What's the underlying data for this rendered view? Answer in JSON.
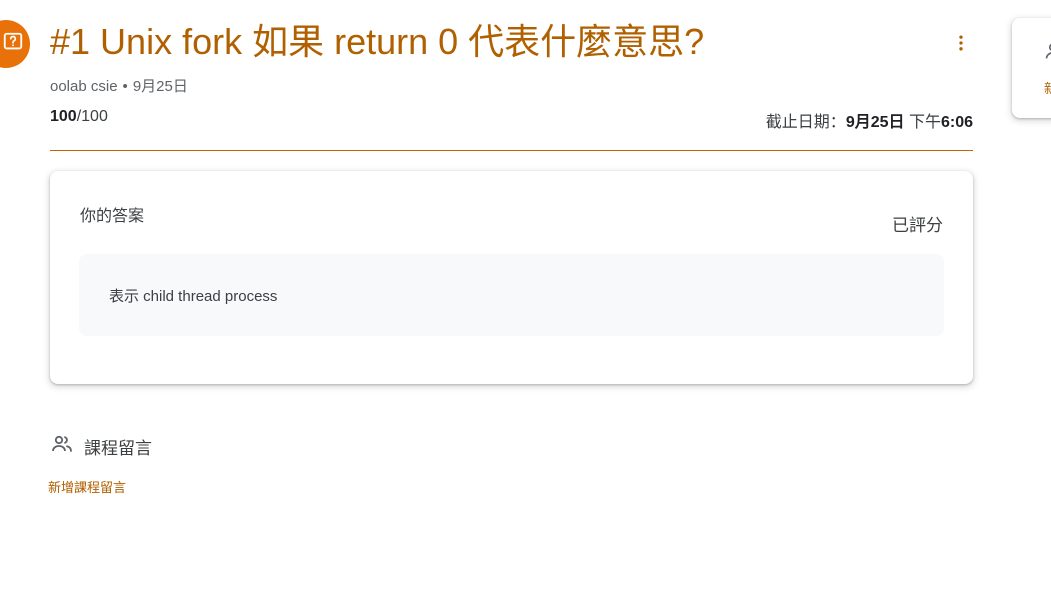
{
  "assignment": {
    "title": "#1 Unix fork 如果 return 0 代表什麼意思?",
    "author": "oolab csie",
    "separator": "•",
    "posted_date": "9月25日",
    "points_earned": "100",
    "points_total": "/100",
    "due_label": "截止日期：",
    "due_date": "9月25日",
    "due_time_prefix": " 下午",
    "due_time": "6:06"
  },
  "your_answer": {
    "heading": "你的答案",
    "status": "已評分",
    "text": "表示 child thread process"
  },
  "class_comments": {
    "title": "課程留言",
    "add_label": "新增課程留言"
  },
  "side_panel": {
    "link_label": "新"
  },
  "colors": {
    "accent": "#b06000",
    "avatar_bg": "#e8710a",
    "divider": "#c26401",
    "answer_box_bg": "#f8f9fa"
  },
  "icons": {
    "assignment_type": "question-icon",
    "menu": "more-vert-icon",
    "comments": "people-icon",
    "side_panel": "person-icon"
  }
}
